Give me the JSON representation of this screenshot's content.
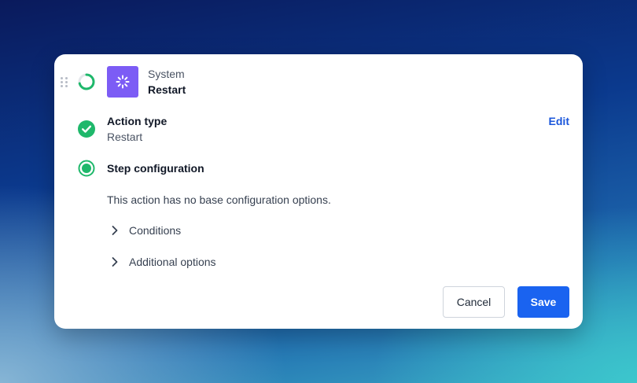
{
  "header": {
    "app_name": "System",
    "action_name": "Restart",
    "app_icon": "loader-icon",
    "app_icon_color": "#7c5cf5"
  },
  "steps": {
    "action_type": {
      "title": "Action type",
      "value": "Restart",
      "status": "complete",
      "edit_label": "Edit"
    },
    "step_configuration": {
      "title": "Step configuration",
      "status": "active",
      "description": "This action has no base configuration options."
    }
  },
  "expanders": {
    "conditions": "Conditions",
    "additional_options": "Additional options"
  },
  "footer": {
    "cancel_label": "Cancel",
    "save_label": "Save"
  },
  "colors": {
    "success": "#1fb86b",
    "primary": "#1a63f0",
    "link": "#1a56db"
  }
}
